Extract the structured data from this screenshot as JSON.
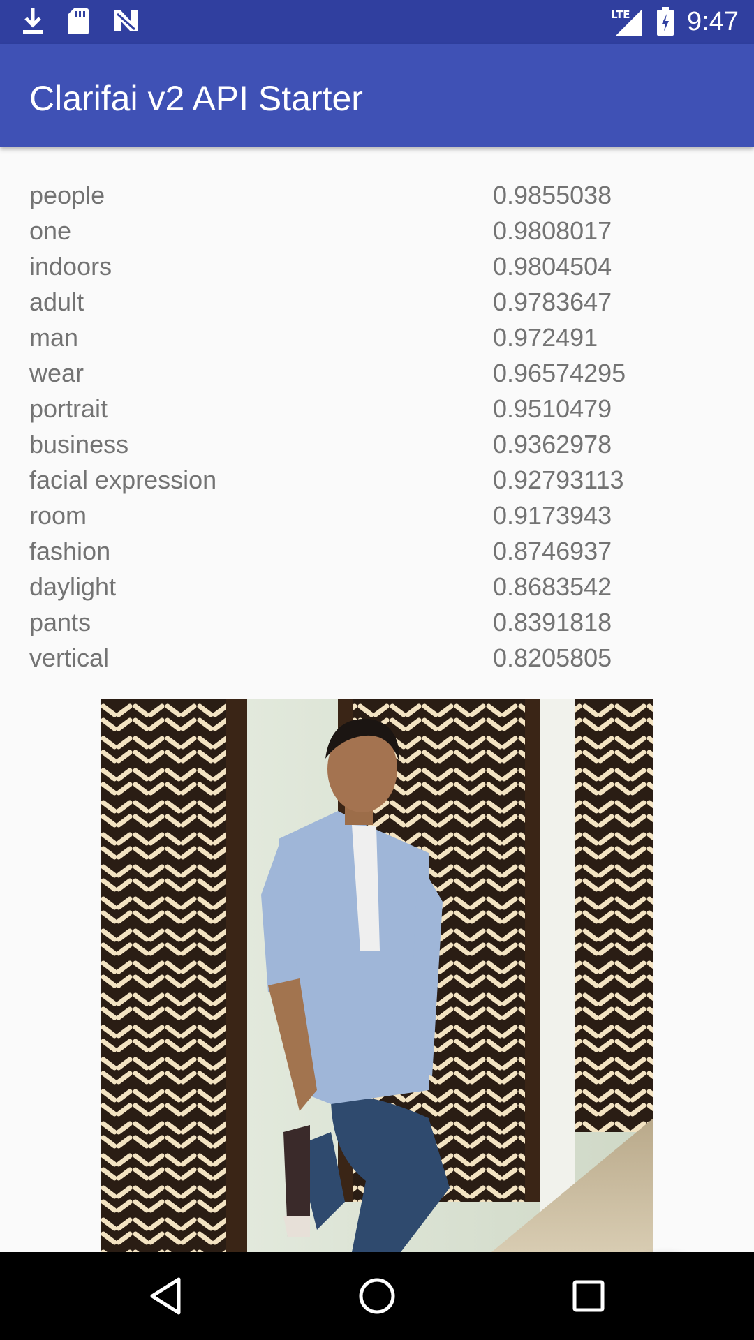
{
  "status_bar": {
    "time": "9:47",
    "network_label": "LTE",
    "icons": [
      "download-icon",
      "sd-card-icon",
      "n-logo-icon",
      "signal-icon",
      "battery-icon"
    ]
  },
  "app_bar": {
    "title": "Clarifai v2 API Starter",
    "color": "#3f51b5"
  },
  "tags": [
    {
      "name": "people",
      "score": "0.9855038"
    },
    {
      "name": "one",
      "score": "0.9808017"
    },
    {
      "name": "indoors",
      "score": "0.9804504"
    },
    {
      "name": "adult",
      "score": "0.9783647"
    },
    {
      "name": "man",
      "score": "0.972491"
    },
    {
      "name": "wear",
      "score": "0.96574295"
    },
    {
      "name": "portrait",
      "score": "0.9510479"
    },
    {
      "name": "business",
      "score": "0.9362978"
    },
    {
      "name": "facial expression",
      "score": "0.92793113"
    },
    {
      "name": "room",
      "score": "0.9173943"
    },
    {
      "name": "fashion",
      "score": "0.8746937"
    },
    {
      "name": "daylight",
      "score": "0.8683542"
    },
    {
      "name": "pants",
      "score": "0.8391818"
    },
    {
      "name": "vertical",
      "score": "0.8205805"
    }
  ],
  "fab": {
    "icon": "upload-icon"
  },
  "nav_bar": {
    "icons": [
      "back-icon",
      "home-icon",
      "recents-icon"
    ]
  }
}
